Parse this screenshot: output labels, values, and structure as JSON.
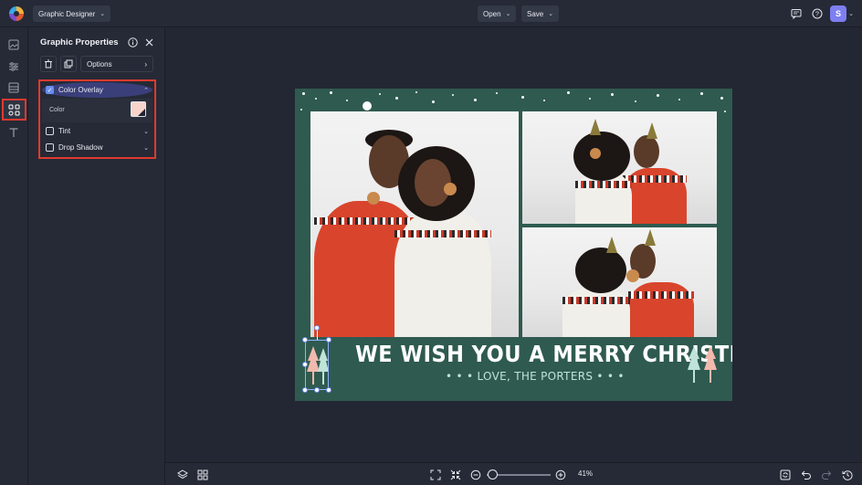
{
  "app": {
    "mode_label": "Graphic Designer",
    "open_label": "Open",
    "save_label": "Save",
    "user_initial": "S"
  },
  "panel": {
    "title": "Graphic Properties",
    "options_label": "Options"
  },
  "effects": {
    "color_overlay": {
      "label": "Color Overlay",
      "checked": true,
      "color_label": "Color",
      "color": "#f6d4cc"
    },
    "tint": {
      "label": "Tint",
      "checked": false
    },
    "drop_shadow": {
      "label": "Drop Shadow",
      "checked": false
    }
  },
  "card": {
    "title": "WE WISH YOU A MERRY CHRISTMAS",
    "subtitle": "• • •  LOVE, THE PORTERS  • • •",
    "background": "#2f5a4f"
  },
  "zoom": {
    "label": "41%",
    "level": 0.41
  },
  "colors": {
    "accent": "#7e7ff0",
    "highlight": "#e03a2f",
    "selection": "#6a8df0"
  },
  "icons": {
    "rail": [
      "image-icon",
      "adjustments-icon",
      "layout-icon",
      "graphics-icon",
      "text-icon"
    ],
    "bottom": [
      "layers-icon",
      "grid-icon",
      "fit-icon",
      "shrink-icon",
      "zoom-out-icon",
      "zoom-in-icon",
      "refresh-icon",
      "undo-icon",
      "redo-icon",
      "history-icon"
    ]
  }
}
